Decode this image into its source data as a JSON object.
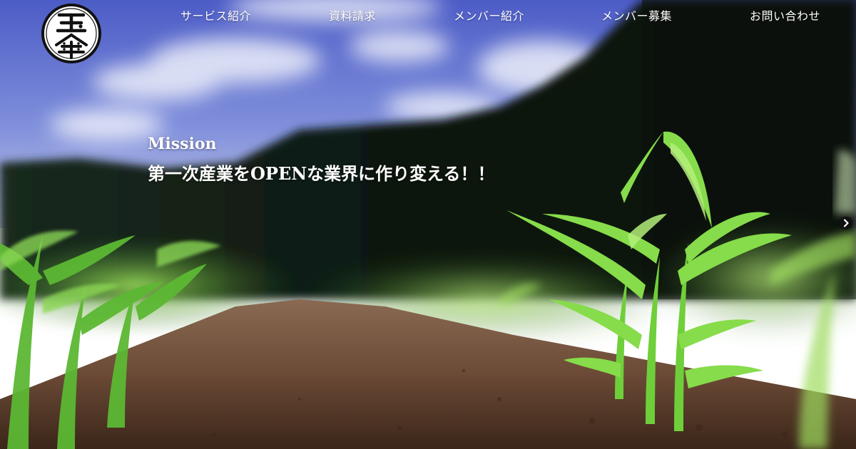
{
  "nav": {
    "items": [
      {
        "label": "サービス紹介"
      },
      {
        "label": "資料請求"
      },
      {
        "label": "メンバー紹介"
      },
      {
        "label": "メンバー募集"
      },
      {
        "label": "お問い合わせ"
      }
    ]
  },
  "logo": {
    "icon": "tamagasa-logo-icon",
    "lettering": [
      "玉",
      "傘"
    ]
  },
  "hero": {
    "label": "Mission",
    "statement": "第一次産業をOPENな業界に作り変える！！",
    "image": "corn-seedlings-field",
    "next_icon": "chevron-right-icon"
  },
  "colors": {
    "sky": "#5a6fd0",
    "forest": "#0f1a12",
    "leaf": "#6fcf3a",
    "soil": "#6b4a36",
    "nav_text": "#ffffff"
  }
}
